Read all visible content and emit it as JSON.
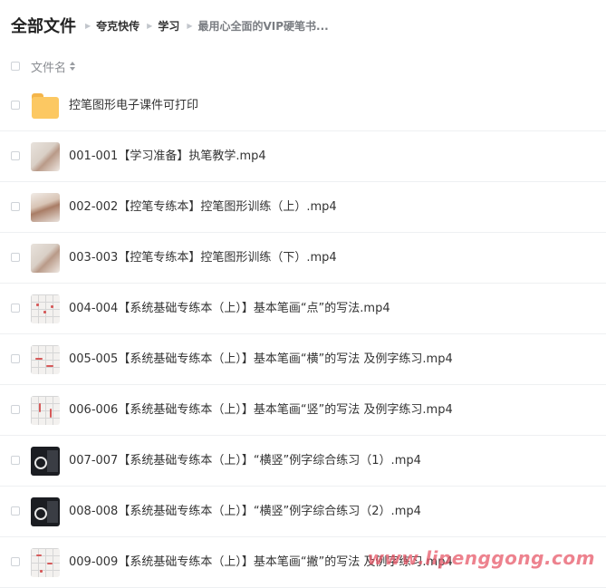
{
  "breadcrumb": {
    "root": "全部文件",
    "items": [
      "夸克快传",
      "学习",
      "最用心全面的VIP硬笔书..."
    ]
  },
  "list_header": {
    "name_column": "文件名"
  },
  "files": [
    {
      "name": "控笔图形电子课件可打印",
      "icon": "folder-icon"
    },
    {
      "name": "001-001【学习准备】执笔教学.mp4",
      "icon": "video-thumbnail"
    },
    {
      "name": "002-002【控笔专练本】控笔图形训练（上）.mp4",
      "icon": "video-thumbnail"
    },
    {
      "name": "003-003【控笔专练本】控笔图形训练（下）.mp4",
      "icon": "video-thumbnail"
    },
    {
      "name": "004-004【系统基础专练本（上）】基本笔画“点”的写法.mp4",
      "icon": "video-thumbnail"
    },
    {
      "name": "005-005【系统基础专练本（上）】基本笔画“横”的写法 及例字练习.mp4",
      "icon": "video-thumbnail"
    },
    {
      "name": "006-006【系统基础专练本（上）】基本笔画“竖”的写法 及例字练习.mp4",
      "icon": "video-thumbnail"
    },
    {
      "name": "007-007【系统基础专练本（上）】“横竖”例字综合练习（1）.mp4",
      "icon": "video-thumbnail"
    },
    {
      "name": "008-008【系统基础专练本（上）】“横竖”例字综合练习（2）.mp4",
      "icon": "video-thumbnail"
    },
    {
      "name": "009-009【系统基础专练本（上）】基本笔画“撇”的写法 及例字练习.mp4",
      "icon": "video-thumbnail"
    }
  ],
  "watermark": "www.lipenggong.com",
  "colors": {
    "folder": "#fcc862",
    "watermark": "#e75868"
  }
}
